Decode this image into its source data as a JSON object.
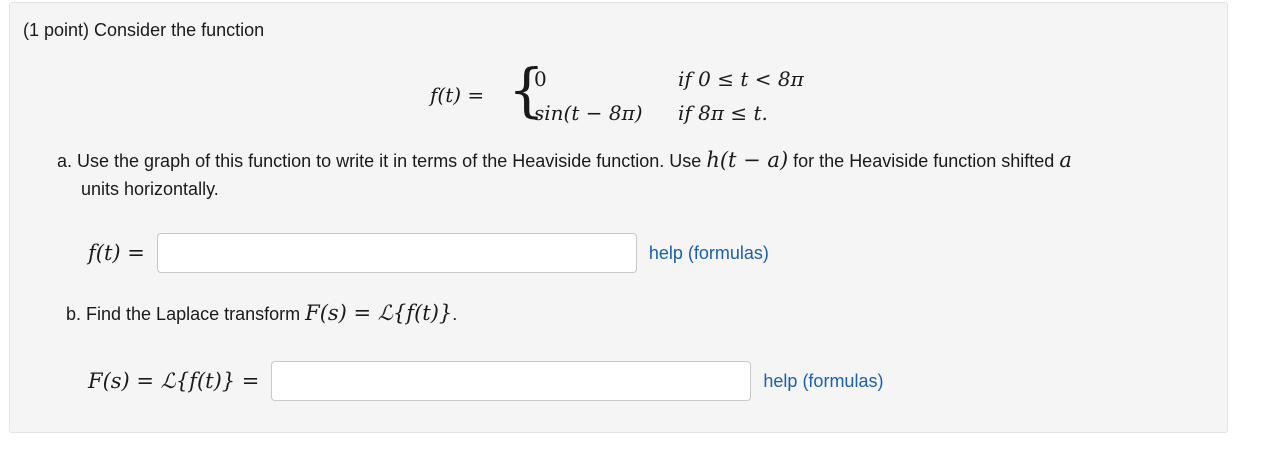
{
  "problem": {
    "intro": "(1 point) Consider the function",
    "function": {
      "lhs": "f(t) =",
      "case1_value": "0",
      "case1_condition": "if 0 ≤ t < 8π",
      "case2_value": "sin(t − 8π)",
      "case2_condition": "if 8π ≤ t."
    },
    "part_a": {
      "text_before": "a. Use the graph of this function to write it in terms of the Heaviside function. Use ",
      "math_inline": "h(t − a)",
      "text_middle": " for the Heaviside function shifted ",
      "math_var": "a",
      "text_after": "units horizontally.",
      "answer_lhs": "f(t) =",
      "answer_value": "",
      "help_label": "help (formulas)"
    },
    "part_b": {
      "text": "b. Find the Laplace transform ",
      "math": "F(s) = ℒ{f(t)}",
      "period": ".",
      "answer_lhs": "F(s) = ℒ{f(t)} =",
      "answer_value": "",
      "help_label": "help (formulas)"
    }
  }
}
